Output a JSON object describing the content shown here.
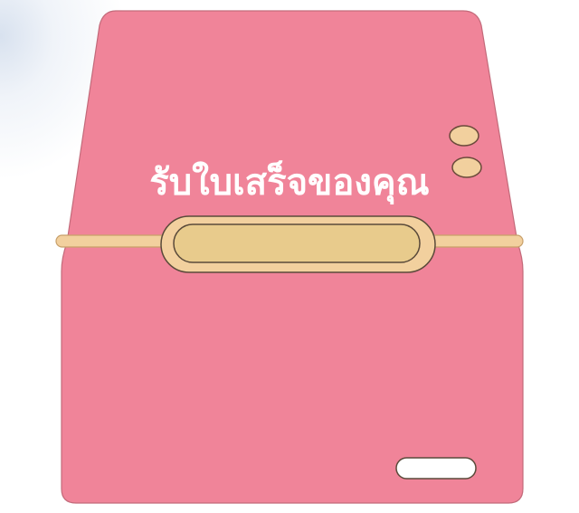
{
  "title": "รับใบเสร็จของคุณ",
  "colors": {
    "printer_body": "#f08499",
    "printer_outline": "#c36a7a",
    "slot_bar": "#f2d09e",
    "slot_slit": "#e8cb8c",
    "indicator": "#f2d09e",
    "feed_button": "#ffffff"
  },
  "icons": {
    "printer": "receipt-printer-icon",
    "paper_slot": "paper-slot-icon",
    "indicator_lights": "indicator-light-icon",
    "feed_button": "feed-button-icon"
  }
}
